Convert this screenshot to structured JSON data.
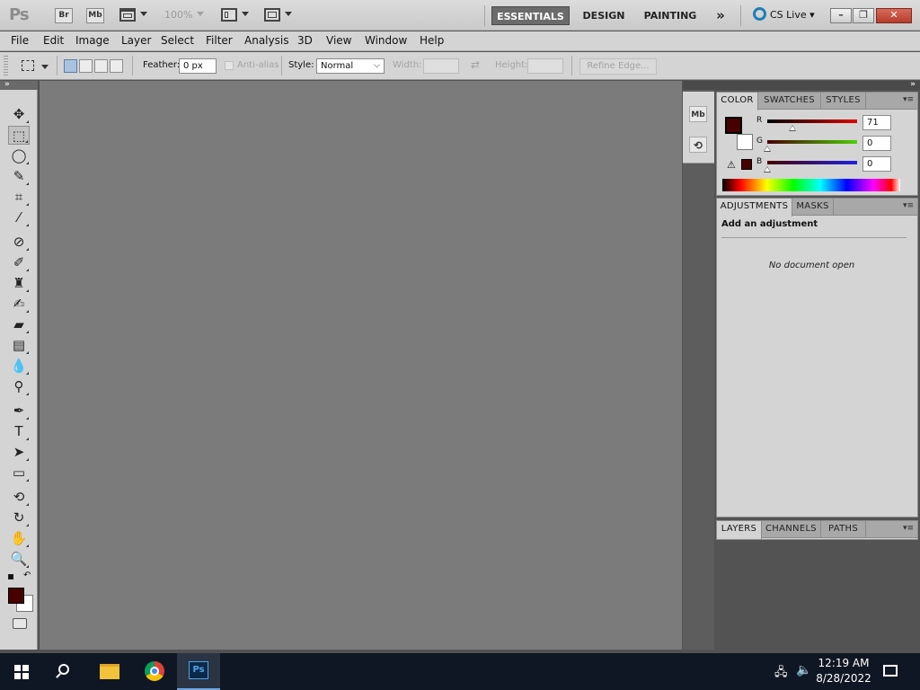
{
  "app": {
    "logo": "Ps"
  },
  "appbar": {
    "bridge_label": "Br",
    "minibridge_label": "Mb",
    "zoom_level": "100%",
    "workspaces": [
      {
        "label": "ESSENTIALS",
        "active": true
      },
      {
        "label": "DESIGN",
        "active": false
      },
      {
        "label": "PAINTING",
        "active": false
      }
    ],
    "more_label": "»",
    "cslive_label": "CS Live",
    "window_controls": {
      "minimize": "–",
      "restore": "❐",
      "close": "✕"
    }
  },
  "menu": [
    "File",
    "Edit",
    "Image",
    "Layer",
    "Select",
    "Filter",
    "Analysis",
    "3D",
    "View",
    "Window",
    "Help"
  ],
  "options": {
    "feather_label": "Feather:",
    "feather_value": "0 px",
    "antialias_label": "Anti-alias",
    "style_label": "Style:",
    "style_value": "Normal",
    "width_label": "Width:",
    "height_label": "Height:",
    "refine_label": "Refine Edge..."
  },
  "tools": [
    {
      "name": "move-tool",
      "icon": "move-icon",
      "glyph": "✥"
    },
    {
      "name": "rectangular-marquee-tool",
      "icon": "marquee-icon",
      "glyph": "⬚",
      "active": true
    },
    {
      "name": "lasso-tool",
      "icon": "lasso-icon",
      "glyph": "◯"
    },
    {
      "name": "quick-selection-tool",
      "icon": "quick-selection-icon",
      "glyph": "✎"
    },
    {
      "name": "crop-tool",
      "icon": "crop-icon",
      "glyph": "⌗"
    },
    {
      "name": "eyedropper-tool",
      "icon": "eyedropper-icon",
      "glyph": "⁄"
    },
    {
      "name": "healing-brush-tool",
      "icon": "bandage-icon",
      "glyph": "⊘"
    },
    {
      "name": "brush-tool",
      "icon": "brush-icon",
      "glyph": "✐"
    },
    {
      "name": "clone-stamp-tool",
      "icon": "stamp-icon",
      "glyph": "♜"
    },
    {
      "name": "history-brush-tool",
      "icon": "history-brush-icon",
      "glyph": "✍"
    },
    {
      "name": "eraser-tool",
      "icon": "eraser-icon",
      "glyph": "▰"
    },
    {
      "name": "gradient-tool",
      "icon": "gradient-icon",
      "glyph": "▤"
    },
    {
      "name": "blur-tool",
      "icon": "drop-icon",
      "glyph": "💧"
    },
    {
      "name": "dodge-tool",
      "icon": "dodge-icon",
      "glyph": "⚲"
    },
    {
      "name": "pen-tool",
      "icon": "pen-icon",
      "glyph": "✒"
    },
    {
      "name": "type-tool",
      "icon": "type-icon",
      "glyph": "T"
    },
    {
      "name": "path-selection-tool",
      "icon": "arrow-icon",
      "glyph": "➤"
    },
    {
      "name": "shape-tool",
      "icon": "rectangle-icon",
      "glyph": "▭"
    },
    {
      "name": "3d-rotate-tool",
      "icon": "3d-rotate-icon",
      "glyph": "⟲"
    },
    {
      "name": "3d-orbit-tool",
      "icon": "3d-orbit-icon",
      "glyph": "↻"
    },
    {
      "name": "hand-tool",
      "icon": "hand-icon",
      "glyph": "✋"
    },
    {
      "name": "zoom-tool",
      "icon": "zoom-icon",
      "glyph": "🔍"
    }
  ],
  "colors": {
    "foreground": "#470000",
    "background": "#ffffff",
    "accent": "#6b6b6b"
  },
  "color_panel": {
    "tabs": [
      "COLOR",
      "SWATCHES",
      "STYLES"
    ],
    "channels": [
      {
        "label": "R",
        "value": "71"
      },
      {
        "label": "G",
        "value": "0"
      },
      {
        "label": "B",
        "value": "0"
      }
    ]
  },
  "adjustments_panel": {
    "tabs": [
      "ADJUSTMENTS",
      "MASKS"
    ],
    "heading": "Add an adjustment",
    "empty_text": "No document open"
  },
  "layers_panel": {
    "tabs": [
      "LAYERS",
      "CHANNELS",
      "PATHS"
    ]
  },
  "taskbar": {
    "time": "12:19 AM",
    "date": "8/28/2022"
  }
}
